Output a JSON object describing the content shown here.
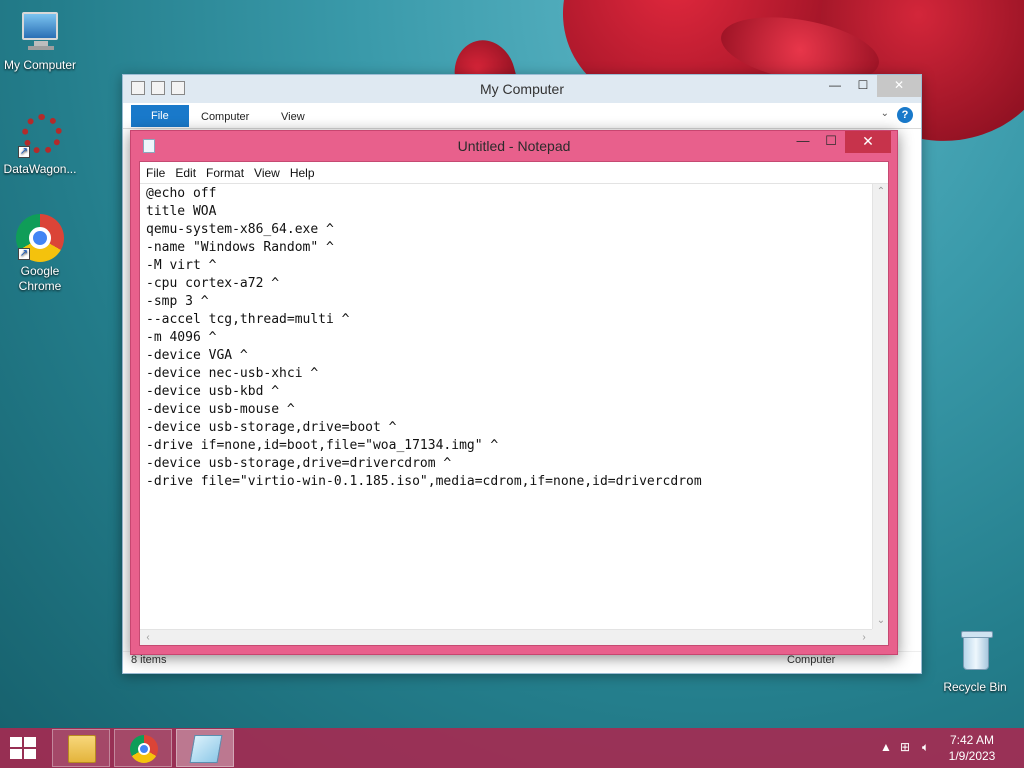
{
  "desktop": {
    "icons": [
      {
        "label": "My Computer"
      },
      {
        "label": "DataWagon..."
      },
      {
        "label": "Google Chrome"
      },
      {
        "label": "Recycle Bin"
      }
    ]
  },
  "explorer": {
    "title": "My Computer",
    "tabs": [
      "File",
      "Computer",
      "View"
    ],
    "status_items": "8 items",
    "status_location": "Computer"
  },
  "notepad": {
    "title": "Untitled - Notepad",
    "menu": [
      "File",
      "Edit",
      "Format",
      "View",
      "Help"
    ],
    "content": "@echo off\ntitle WOA\nqemu-system-x86_64.exe ^\n-name \"Windows Random\" ^\n-M virt ^\n-cpu cortex-a72 ^\n-smp 3 ^\n--accel tcg,thread=multi ^\n-m 4096 ^\n-device VGA ^\n-device nec-usb-xhci ^\n-device usb-kbd ^\n-device usb-mouse ^\n-device usb-storage,drive=boot ^\n-drive if=none,id=boot,file=\"woa_17134.img\" ^\n-device usb-storage,drive=drivercdrom ^\n-drive file=\"virtio-win-0.1.185.iso\",media=cdrom,if=none,id=drivercdrom"
  },
  "taskbar": {
    "time": "7:42 AM",
    "date": "1/9/2023",
    "colors": {
      "taskbar": "#aa2850",
      "notepad_frame": "#e8608c"
    }
  }
}
